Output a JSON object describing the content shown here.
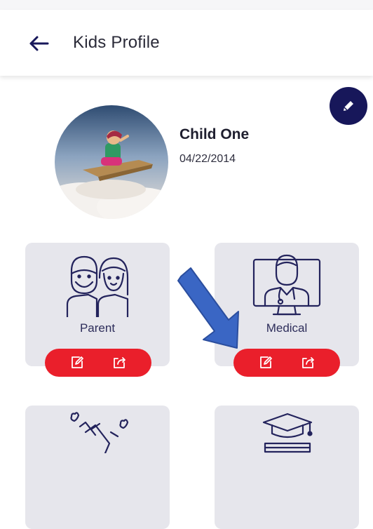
{
  "header": {
    "title": "Kids Profile",
    "back_icon": "arrow-left-icon"
  },
  "profile": {
    "name": "Child One",
    "dob": "04/22/2014",
    "edit_icon": "pencil-icon"
  },
  "cards": [
    {
      "label": "Parent",
      "icon": "parents-icon"
    },
    {
      "label": "Medical",
      "icon": "doctor-monitor-icon"
    },
    {
      "label": "",
      "icon": "clapping-hands-icon"
    },
    {
      "label": "",
      "icon": "graduation-cap-icon"
    }
  ],
  "colors": {
    "primary": "#17175a",
    "accent": "#ea1f2b",
    "card_bg": "#e6e6ec",
    "annotation_arrow": "#3a66c4"
  }
}
